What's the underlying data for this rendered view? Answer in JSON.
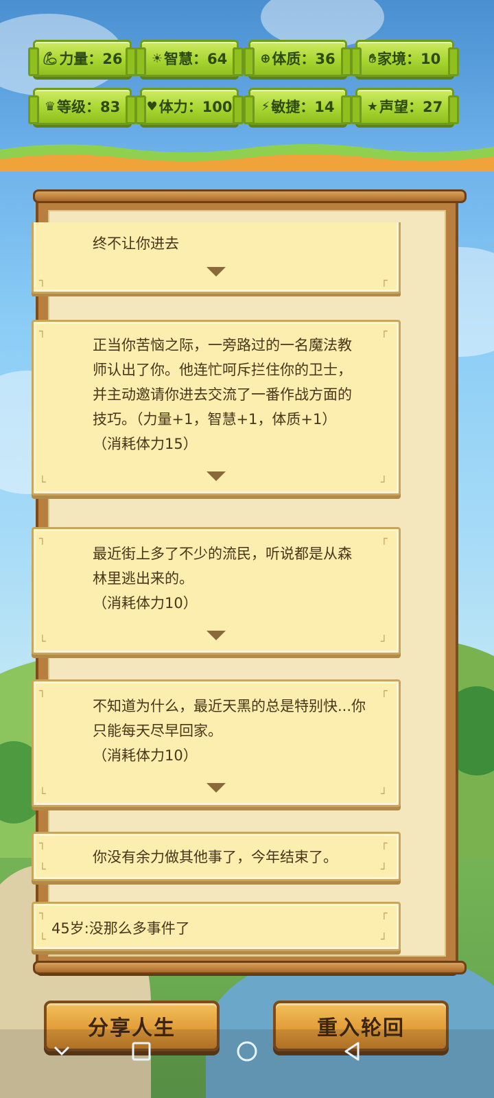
{
  "stats": [
    {
      "icon_name": "muscle-icon",
      "label": "力量：26"
    },
    {
      "icon_name": "lightbulb-icon",
      "label": "智慧：64"
    },
    {
      "icon_name": "plus-circle-icon",
      "label": "体质：36"
    },
    {
      "icon_name": "hands-icon",
      "label": "家境：10"
    },
    {
      "icon_name": "crown-icon",
      "label": "等级：83"
    },
    {
      "icon_name": "heart-icon",
      "label": "体力：100"
    },
    {
      "icon_name": "lightning-icon",
      "label": "敏捷：14"
    },
    {
      "icon_name": "star-icon",
      "label": "声望：27"
    }
  ],
  "events": [
    {
      "text": "终不让你进去",
      "has_arrow": true
    },
    {
      "text": "正当你苦恼之际，一旁路过的一名魔法教\n师认出了你。他连忙呵斥拦住你的卫士，\n并主动邀请你进去交流了一番作战方面的\n技巧。（力量+1，智慧+1，体质+1）\n（消耗体力15）",
      "has_arrow": true
    },
    {
      "text": "最近街上多了不少的流民，听说都是从森\n林里逃出来的。\n（消耗体力10）",
      "has_arrow": true
    },
    {
      "text": "不知道为什么，最近天黑的总是特别快...你\n只能每天尽早回家。\n（消耗体力10）",
      "has_arrow": true
    },
    {
      "text": "你没有余力做其他事了，今年结束了。",
      "has_arrow": false
    },
    {
      "text": "45岁:没那么多事件了",
      "has_arrow": false
    }
  ],
  "buttons": {
    "share": "分享人生",
    "restart": "重入轮回"
  },
  "colors": {
    "stat_badge": "#a9d632",
    "card_bg": "#fbeeaf",
    "frame_wood": "#b97f3e",
    "button": "#e19b36"
  }
}
